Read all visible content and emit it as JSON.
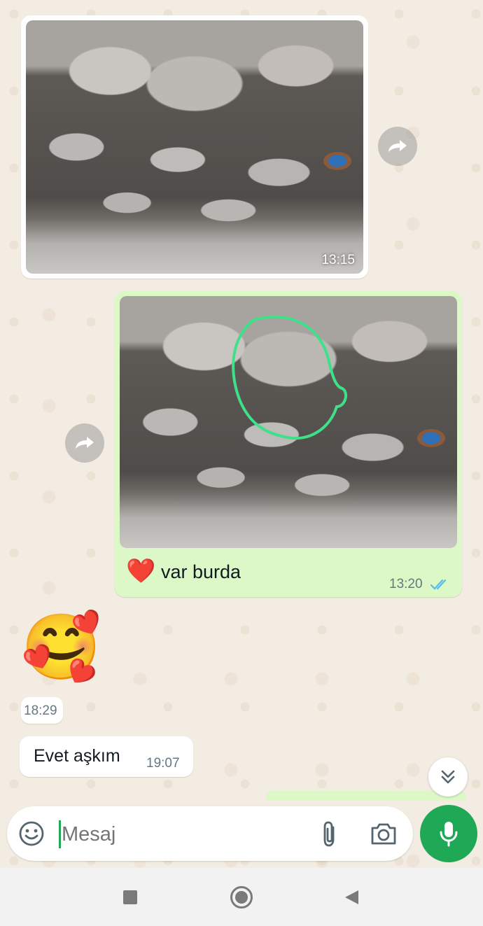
{
  "messages": {
    "msg1": {
      "time": "13:15"
    },
    "msg2": {
      "text": "var burda",
      "time": "13:20",
      "emoji": "❤️"
    },
    "msg3": {
      "emoji": "🥰",
      "time": "18:29"
    },
    "msg4": {
      "text": "Evet aşkım",
      "time": "19:07"
    }
  },
  "composer": {
    "placeholder": "Mesaj"
  },
  "icons": {
    "emoji": "emoji-icon",
    "attach": "paperclip-icon",
    "camera": "camera-icon",
    "mic": "microphone-icon",
    "scroll": "double-chevron-down-icon",
    "forward": "forward-icon"
  },
  "colors": {
    "accent": "#1fa855",
    "outgoing_bubble": "#dcf8c6",
    "incoming_bubble": "#ffffff",
    "read_ticks": "#53bdeb",
    "annotation_stroke": "#3ee08a"
  }
}
